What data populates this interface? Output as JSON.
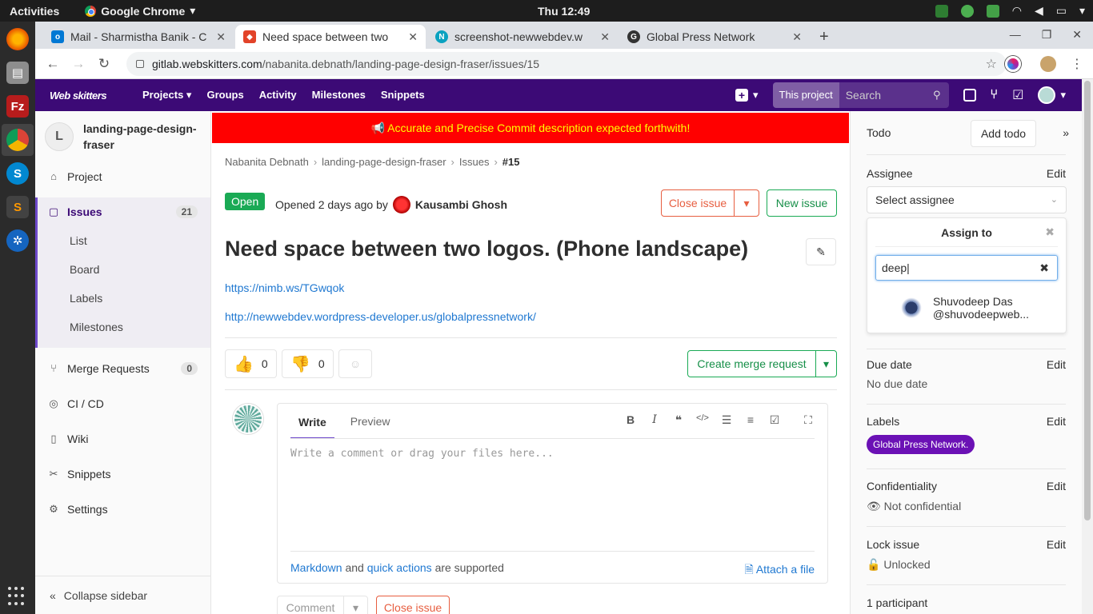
{
  "os": {
    "activities": "Activities",
    "app_name": "Google Chrome",
    "clock": "Thu 12:49"
  },
  "browser": {
    "tabs": [
      {
        "title": "Mail - Sharmistha Banik - C",
        "favicon_color": "#0078d4"
      },
      {
        "title": "Need space between two",
        "favicon_color": "#e24329"
      },
      {
        "title": "screenshot-newwebdev.w",
        "favicon_color": "#0aa2c0"
      },
      {
        "title": "Global Press Network",
        "favicon_color": "#333333"
      }
    ],
    "url_host": "gitlab.webskitters.com",
    "url_path": "/nabanita.debnath/landing-page-design-fraser/issues/15"
  },
  "gitlab_header": {
    "logo": "Web skitters",
    "nav": [
      "Projects",
      "Groups",
      "Activity",
      "Milestones",
      "Snippets"
    ],
    "search_scope": "This project",
    "search_placeholder": "Search",
    "brand_color": "#3c0a76"
  },
  "sidebar": {
    "project_initial": "L",
    "project_name": "landing-page-design-fraser",
    "items": [
      {
        "label": "Project",
        "icon": "home-icon"
      },
      {
        "label": "Issues",
        "icon": "issues-icon",
        "count": "21"
      },
      {
        "label": "Merge Requests",
        "icon": "merge-icon",
        "count": "0"
      },
      {
        "label": "CI / CD",
        "icon": "rocket-icon"
      },
      {
        "label": "Wiki",
        "icon": "book-icon"
      },
      {
        "label": "Snippets",
        "icon": "scissors-icon"
      },
      {
        "label": "Settings",
        "icon": "gear-icon"
      }
    ],
    "issue_subitems": [
      "List",
      "Board",
      "Labels",
      "Milestones"
    ],
    "collapse": "Collapse sidebar"
  },
  "banner": {
    "text": "📢 Accurate and Precise Commit description expected forthwith!",
    "bg": "#ff0000",
    "fg": "#ffff00"
  },
  "breadcrumb": [
    "Nabanita Debnath",
    "landing-page-design-fraser",
    "Issues",
    "#15"
  ],
  "issue": {
    "status": "Open",
    "opened_text": "Opened 2 days ago by",
    "author": "Kausambi Ghosh",
    "close_label": "Close issue",
    "new_label": "New issue",
    "title": "Need space between two logos. (Phone landscape)",
    "links": [
      "https://nimb.ws/TGwqok",
      "http://newwebdev.wordpress-developer.us/globalpressnetwork/"
    ],
    "thumbs_up": "0",
    "thumbs_down": "0",
    "create_mr": "Create merge request"
  },
  "editor": {
    "write_tab": "Write",
    "preview_tab": "Preview",
    "placeholder": "Write a comment or drag your files here...",
    "footer_markdown": "Markdown",
    "footer_and": "and",
    "footer_quick": "quick actions",
    "footer_supported": "are supported",
    "attach": "Attach a file",
    "comment_btn": "Comment",
    "close_btn": "Close issue"
  },
  "right_sidebar": {
    "todo": "Todo",
    "add_todo": "Add todo",
    "assignee": "Assignee",
    "edit": "Edit",
    "select_assignee": "Select assignee",
    "assign_to": "Assign to",
    "filter_value": "deep",
    "user_name": "Shuvodeep Das",
    "user_handle": "@shuvodeepweb...",
    "due_date": "Due date",
    "no_due": "No due date",
    "labels": "Labels",
    "label_pill": "Global Press Network.",
    "confidentiality": "Confidentiality",
    "not_confidential": "Not confidential",
    "lock_issue": "Lock issue",
    "unlocked": "Unlocked",
    "participants": "1 participant"
  }
}
